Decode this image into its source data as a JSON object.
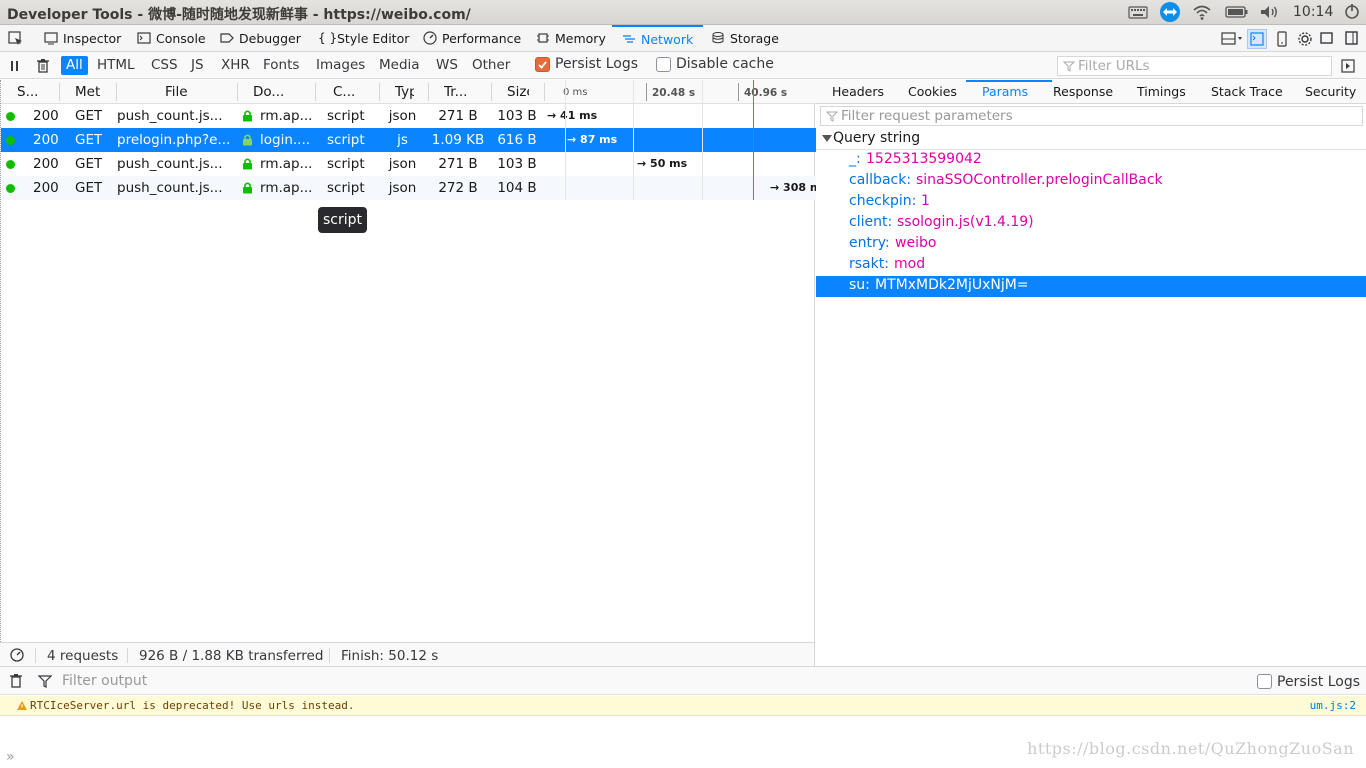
{
  "window": {
    "title": "Developer Tools - 微博-随时随地发现新鲜事 - https://weibo.com/",
    "clock": "10:14"
  },
  "tabs": [
    {
      "label": "Inspector",
      "icon": "inspector-icon"
    },
    {
      "label": "Console",
      "icon": "console-icon"
    },
    {
      "label": "Debugger",
      "icon": "debugger-icon"
    },
    {
      "label": "Style Editor",
      "icon": "style-editor-icon"
    },
    {
      "label": "Performance",
      "icon": "performance-icon"
    },
    {
      "label": "Memory",
      "icon": "memory-icon"
    },
    {
      "label": "Network",
      "icon": "network-icon",
      "selected": true
    },
    {
      "label": "Storage",
      "icon": "storage-icon"
    }
  ],
  "filters": {
    "types": [
      "All",
      "HTML",
      "CSS",
      "JS",
      "XHR",
      "Fonts",
      "Images",
      "Media",
      "WS",
      "Other"
    ],
    "selected": "All",
    "persist_logs": "Persist Logs",
    "disable_cache": "Disable cache",
    "filter_urls_placeholder": "Filter URLs"
  },
  "columns": [
    "S...",
    "Met",
    "File",
    "Do...",
    "C...",
    "Typ",
    "Tr...",
    "Size"
  ],
  "waterfall_ticks": [
    "0 ms",
    "20.48 s",
    "40.96 s"
  ],
  "requests": [
    {
      "status": "200",
      "method": "GET",
      "file": "push_count.js...",
      "domain": "rm.ap...",
      "cause": "script",
      "type": "json",
      "transferred": "271 B",
      "size": "103 B",
      "timing": "→ 41 ms"
    },
    {
      "status": "200",
      "method": "GET",
      "file": "prelogin.php?e...",
      "domain": "login....",
      "cause": "script",
      "type": "js",
      "transferred": "1.09 KB",
      "size": "616 B",
      "timing": "→ 87 ms"
    },
    {
      "status": "200",
      "method": "GET",
      "file": "push_count.js...",
      "domain": "rm.ap...",
      "cause": "script",
      "type": "json",
      "transferred": "271 B",
      "size": "103 B",
      "timing": "→ 50 ms"
    },
    {
      "status": "200",
      "method": "GET",
      "file": "push_count.js...",
      "domain": "rm.ap...",
      "cause": "script",
      "type": "json",
      "transferred": "272 B",
      "size": "104 B",
      "timing": "→ 308 m"
    }
  ],
  "tooltip": "script",
  "summary": {
    "requests": "4 requests",
    "transferred": "926 B / 1.88 KB transferred",
    "finish": "Finish: 50.12 s"
  },
  "details": {
    "tabs": [
      "Headers",
      "Cookies",
      "Params",
      "Response",
      "Timings",
      "Stack Trace",
      "Security"
    ],
    "selected_tab": "Params",
    "filter_placeholder": "Filter request parameters",
    "section": "Query string",
    "params": [
      {
        "key": "_:",
        "value": "1525313599042"
      },
      {
        "key": "callback:",
        "value": "sinaSSOController.preloginCallBack"
      },
      {
        "key": "checkpin:",
        "value": "1"
      },
      {
        "key": "client:",
        "value": "ssologin.js(v1.4.19)"
      },
      {
        "key": "entry:",
        "value": "weibo"
      },
      {
        "key": "rsakt:",
        "value": "mod"
      },
      {
        "key": "su:",
        "value": "MTMxMDk2MjUxNjM="
      }
    ]
  },
  "console": {
    "filter_placeholder": "Filter output",
    "persist_logs": "Persist Logs",
    "warning": "RTCIceServer.url is deprecated! Use urls instead.",
    "warning_source": "um.js:2",
    "watermark": "https://blog.csdn.net/QuZhongZuoSan"
  }
}
